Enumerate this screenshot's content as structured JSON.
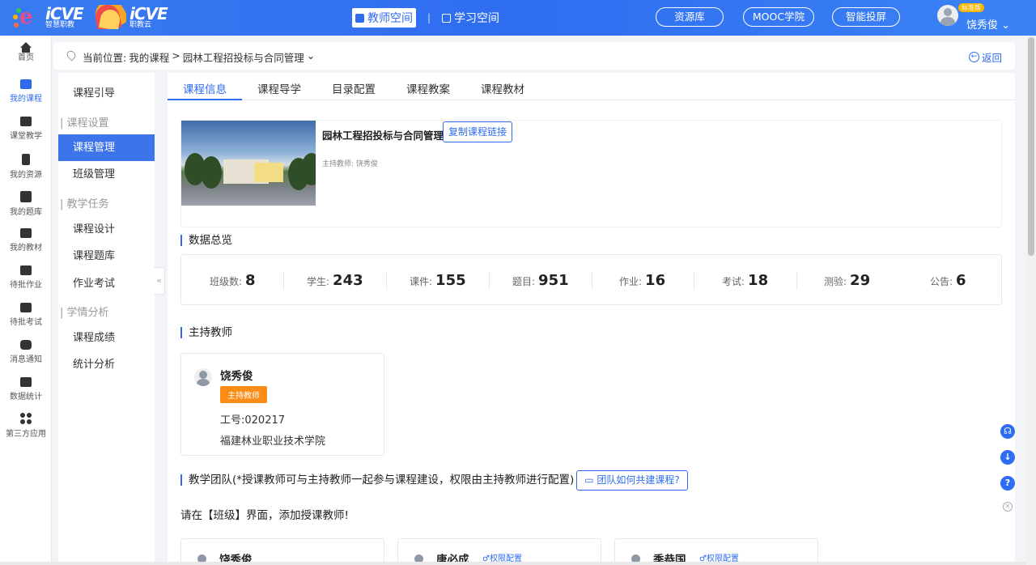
{
  "header": {
    "logo1": {
      "brand": "iCVE",
      "sub": "智慧职教"
    },
    "logo2": {
      "brand": "iCVE",
      "sub": "职教云"
    },
    "nav_teacher": "教师空间",
    "nav_divider": "|",
    "nav_study": "学习空间",
    "pills": [
      "资源库",
      "MOOC学院",
      "智能投屏"
    ],
    "vip_badge": "标准版",
    "user_name": "饶秀俊",
    "user_caret": "⌄"
  },
  "leftnav": [
    {
      "label": "首页",
      "icon": "home-icon"
    },
    {
      "label": "我的课程",
      "icon": "course-icon",
      "active": true
    },
    {
      "label": "课堂教学",
      "icon": "play-icon"
    },
    {
      "label": "我的资源",
      "icon": "resource-icon"
    },
    {
      "label": "我的题库",
      "icon": "question-bank-icon"
    },
    {
      "label": "我的教材",
      "icon": "textbook-icon"
    },
    {
      "label": "待批作业",
      "icon": "homework-icon"
    },
    {
      "label": "待批考试",
      "icon": "exam-icon"
    },
    {
      "label": "消息通知",
      "icon": "message-icon"
    },
    {
      "label": "数据统计",
      "icon": "stats-icon"
    },
    {
      "label": "第三方应用",
      "icon": "apps-icon"
    }
  ],
  "breadcrumb": {
    "prefix": "当前位置:",
    "items": [
      "我的课程",
      ">",
      "园林工程招投标与合同管理",
      "⌄"
    ],
    "back": "返回"
  },
  "sidemenu": {
    "guide": "课程引导",
    "group1": "课程设置",
    "course_manage": "课程管理",
    "class_manage": "班级管理",
    "group2": "教学任务",
    "course_design": "课程设计",
    "course_bank": "课程题库",
    "homework_exam": "作业考试",
    "group3": "学情分析",
    "grades": "课程成绩",
    "analytics": "统计分析"
  },
  "tabs": [
    "课程信息",
    "课程导学",
    "目录配置",
    "课程教案",
    "课程教材"
  ],
  "course": {
    "title": "园林工程招投标与合同管理",
    "copy_link": "复制课程链接",
    "host_teacher": "主持教师: 饶秀俊"
  },
  "overview": {
    "title": "数据总览",
    "stats": [
      {
        "label": "班级数:",
        "value": "8"
      },
      {
        "label": "学生:",
        "value": "243"
      },
      {
        "label": "课件:",
        "value": "155"
      },
      {
        "label": "题目:",
        "value": "951"
      },
      {
        "label": "作业:",
        "value": "16"
      },
      {
        "label": "考试:",
        "value": "18"
      },
      {
        "label": "测验:",
        "value": "29"
      },
      {
        "label": "公告:",
        "value": "6"
      }
    ]
  },
  "host": {
    "title": "主持教师",
    "name": "饶秀俊",
    "tag": "主持教师",
    "id": "工号:020217",
    "org": "福建林业职业技术学院"
  },
  "team": {
    "title": "教学团队(*授课教师可与主持教师一起参与课程建设，权限由主持教师进行配置)",
    "link": "团队如何共建课程?",
    "hint": "请在【班级】界面，添加授课教师!",
    "members": [
      {
        "name": "饶秀俊",
        "perm": ""
      },
      {
        "name": "唐必成",
        "perm": "权限配置"
      },
      {
        "name": "季恭国",
        "perm": "权限配置"
      }
    ]
  },
  "floats": [
    "headset-icon",
    "download-icon",
    "help-icon",
    "close-icon"
  ],
  "colors": {
    "primary": "#2f6df0",
    "tag": "#fa8c16",
    "active_menu": "#3e74ea"
  }
}
